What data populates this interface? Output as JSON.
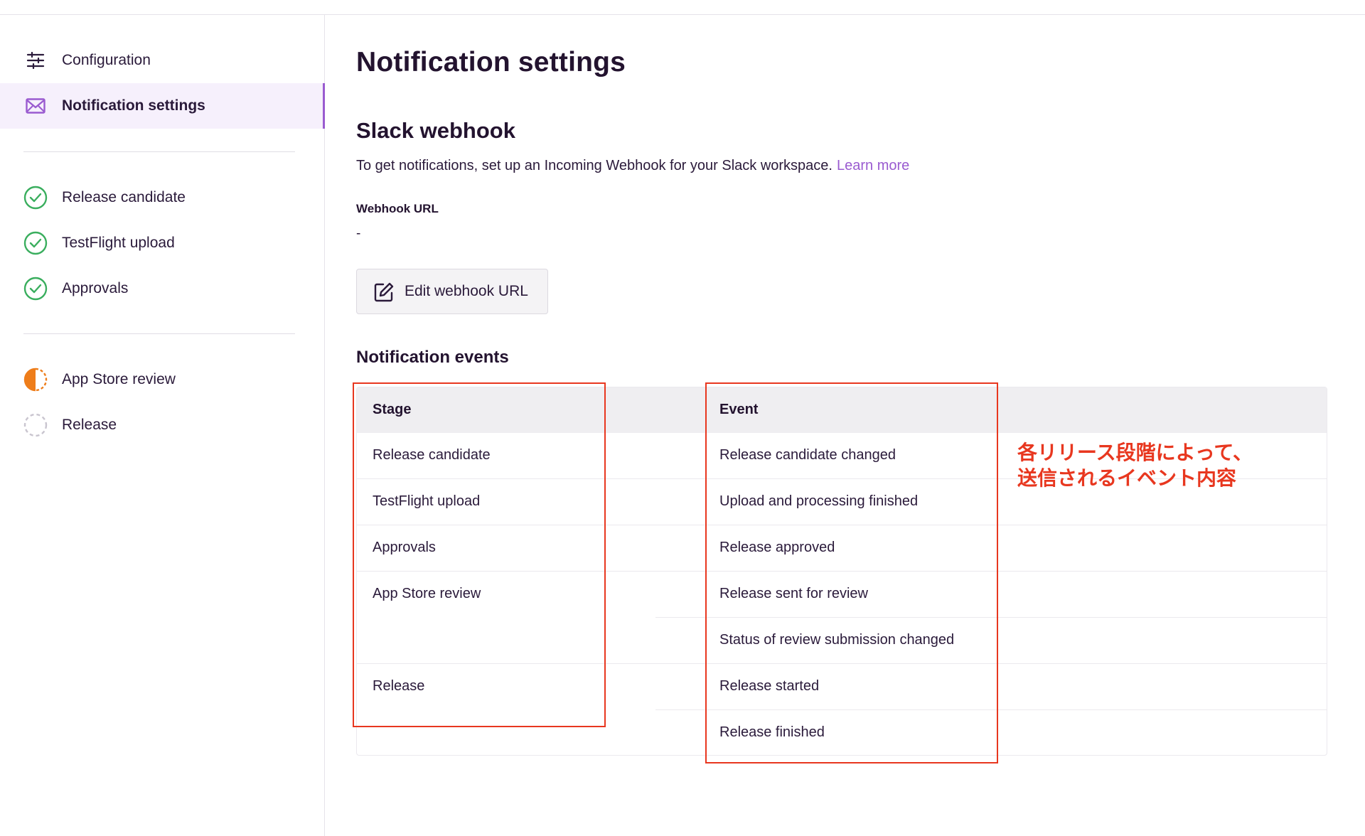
{
  "sidebar": {
    "config_items": [
      {
        "label": "Configuration",
        "icon": "sliders-icon"
      },
      {
        "label": "Notification settings",
        "icon": "envelope-icon"
      }
    ],
    "stage_items": [
      {
        "label": "Release candidate",
        "icon": "check-circle-icon"
      },
      {
        "label": "TestFlight upload",
        "icon": "check-circle-icon"
      },
      {
        "label": "Approvals",
        "icon": "check-circle-icon"
      }
    ],
    "pending_items": [
      {
        "label": "App Store review",
        "icon": "half-circle-icon"
      },
      {
        "label": "Release",
        "icon": "dashed-circle-icon"
      }
    ]
  },
  "main": {
    "title": "Notification settings",
    "slack": {
      "title": "Slack webhook",
      "description": "To get notifications, set up an Incoming Webhook for your Slack workspace.",
      "link": "Learn more",
      "field_label": "Webhook URL",
      "field_value": "-",
      "edit_button": "Edit webhook URL"
    },
    "events": {
      "title": "Notification events",
      "headers": {
        "stage": "Stage",
        "event": "Event"
      },
      "stages": [
        "Release candidate",
        "TestFlight upload",
        "Approvals",
        "App Store review",
        "Release"
      ],
      "events": [
        "Release candidate changed",
        "Upload and processing finished",
        "Release approved",
        "Release sent for review",
        "Status of review submission changed",
        "Release started",
        "Release finished"
      ]
    }
  },
  "annotation": {
    "line1": "各リリース段階によって、",
    "line2": "送信されるイベント内容"
  },
  "colors": {
    "accent": "#9a5bd0",
    "success": "#3aae5e",
    "warning": "#ee7d1a",
    "annotation": "#e8371f"
  }
}
